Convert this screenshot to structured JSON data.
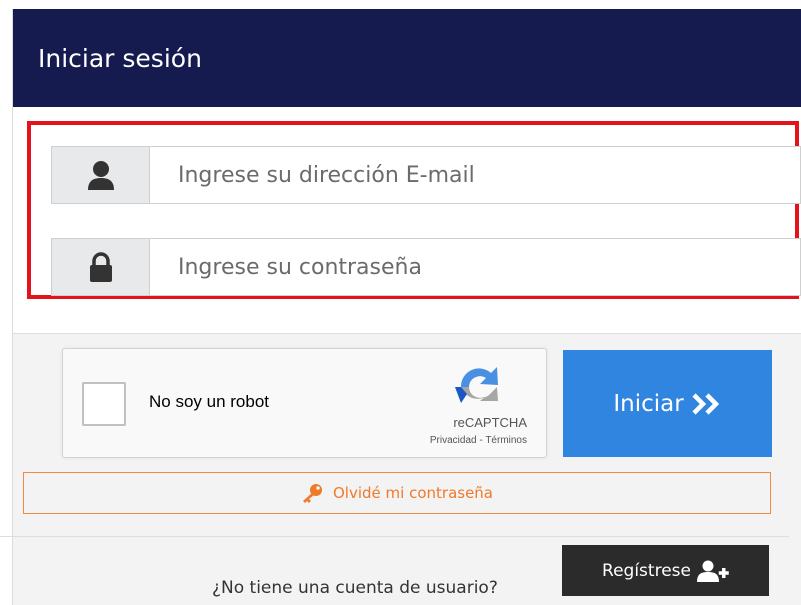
{
  "header": {
    "title": "Iniciar sesión"
  },
  "form": {
    "email": {
      "placeholder": "Ingrese su dirección E-mail",
      "value": "",
      "icon": "user-icon"
    },
    "password": {
      "placeholder": "Ingrese su contraseña",
      "value": "",
      "icon": "lock-icon"
    }
  },
  "recaptcha": {
    "label": "No soy un robot",
    "brand": "reCAPTCHA",
    "privacy": "Privacidad",
    "separator": " - ",
    "terms": "Términos"
  },
  "actions": {
    "submit_label": "Iniciar",
    "forgot_label": "Olvidé mi contraseña"
  },
  "footer": {
    "question": "¿No tiene una cuenta de usuario?",
    "register_label": "Regístrese"
  },
  "colors": {
    "header_bg": "#151b4e",
    "highlight": "#e3131b",
    "primary": "#3085e0",
    "forgot": "#ef7a2a",
    "register_bg": "#2b2b2b"
  }
}
